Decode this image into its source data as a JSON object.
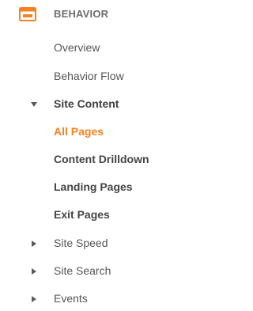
{
  "section": {
    "title": "BEHAVIOR",
    "icon": "behavior-window-icon",
    "accent_color": "#f5821f"
  },
  "items": [
    {
      "label": "Overview"
    },
    {
      "label": "Behavior Flow"
    },
    {
      "label": "Site Content",
      "icon": "caret-down-icon",
      "expanded": true
    },
    {
      "label": "All Pages",
      "active": true
    },
    {
      "label": "Content Drilldown"
    },
    {
      "label": "Landing Pages"
    },
    {
      "label": "Exit Pages"
    },
    {
      "label": "Site Speed",
      "icon": "caret-right-icon",
      "expanded": false
    },
    {
      "label": "Site Search",
      "icon": "caret-right-icon",
      "expanded": false
    },
    {
      "label": "Events",
      "icon": "caret-right-icon",
      "expanded": false
    }
  ]
}
